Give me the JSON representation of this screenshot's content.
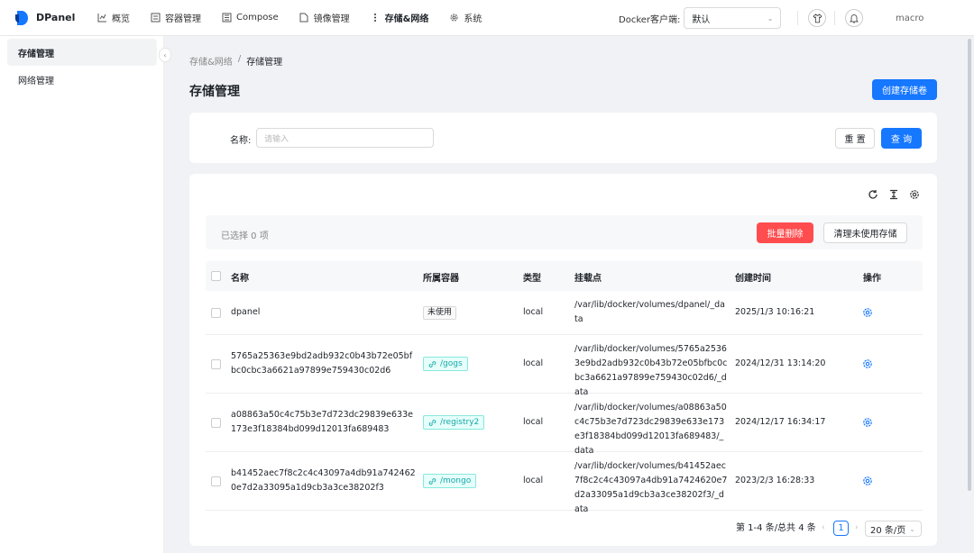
{
  "app": {
    "name": "DPanel"
  },
  "nav": [
    {
      "label": "概览",
      "icon": "chart-icon"
    },
    {
      "label": "容器管理",
      "icon": "container-icon"
    },
    {
      "label": "Compose",
      "icon": "compose-icon"
    },
    {
      "label": "镜像管理",
      "icon": "file-icon"
    },
    {
      "label": "存储&网络",
      "icon": "dots-icon"
    },
    {
      "label": "系统",
      "icon": "gear-icon"
    }
  ],
  "header": {
    "docker_client_label": "Docker客户端:",
    "docker_client_value": "默认",
    "user": "macro"
  },
  "sidebar": {
    "items": [
      {
        "label": "存储管理"
      },
      {
        "label": "网络管理"
      }
    ]
  },
  "breadcrumb": {
    "parent": "存储&网络",
    "sep": "/",
    "current": "存储管理"
  },
  "page": {
    "title": "存储管理",
    "create_label": "创建存储卷"
  },
  "search": {
    "label": "名称:",
    "placeholder": "请输入",
    "reset_label": "重 置",
    "query_label": "查 询"
  },
  "selection": {
    "text": "已选择 0 项",
    "batch_delete_label": "批量删除",
    "prune_label": "清理未使用存储"
  },
  "table": {
    "columns": [
      "名称",
      "所属容器",
      "类型",
      "挂载点",
      "创建时间",
      "操作"
    ],
    "rows": [
      {
        "name": "dpanel",
        "container": "未使用",
        "container_type": "unused",
        "type": "local",
        "mountpoint": "/var/lib/docker/volumes/dpanel/_data",
        "created": "2025/1/3 10:16:21"
      },
      {
        "name": "5765a25363e9bd2adb932c0b43b72e05bfbc0cbc3a6621a97899e759430c02d6",
        "container": "/gogs",
        "container_type": "link",
        "type": "local",
        "mountpoint": "/var/lib/docker/volumes/5765a25363e9bd2adb932c0b43b72e05bfbc0cbc3a6621a97899e759430c02d6/_data",
        "created": "2024/12/31 13:14:20"
      },
      {
        "name": "a08863a50c4c75b3e7d723dc29839e633e173e3f18384bd099d12013fa689483",
        "container": "/registry2",
        "container_type": "link",
        "type": "local",
        "mountpoint": "/var/lib/docker/volumes/a08863a50c4c75b3e7d723dc29839e633e173e3f18384bd099d12013fa689483/_data",
        "created": "2024/12/17 16:34:17"
      },
      {
        "name": "b41452aec7f8c2c4c43097a4db91a7424620e7d2a33095a1d9cb3a3ce38202f3",
        "container": "/mongo",
        "container_type": "link",
        "type": "local",
        "mountpoint": "/var/lib/docker/volumes/b41452aec7f8c2c4c43097a4db91a7424620e7d2a33095a1d9cb3a3ce38202f3/_data",
        "created": "2023/2/3 16:28:33"
      }
    ]
  },
  "pagination": {
    "summary": "第 1-4 条/总共 4 条",
    "current": "1",
    "page_size": "20 条/页"
  },
  "colors": {
    "primary": "#1677ff",
    "danger": "#ff4d4f",
    "link_tag": "#13a8a8"
  }
}
